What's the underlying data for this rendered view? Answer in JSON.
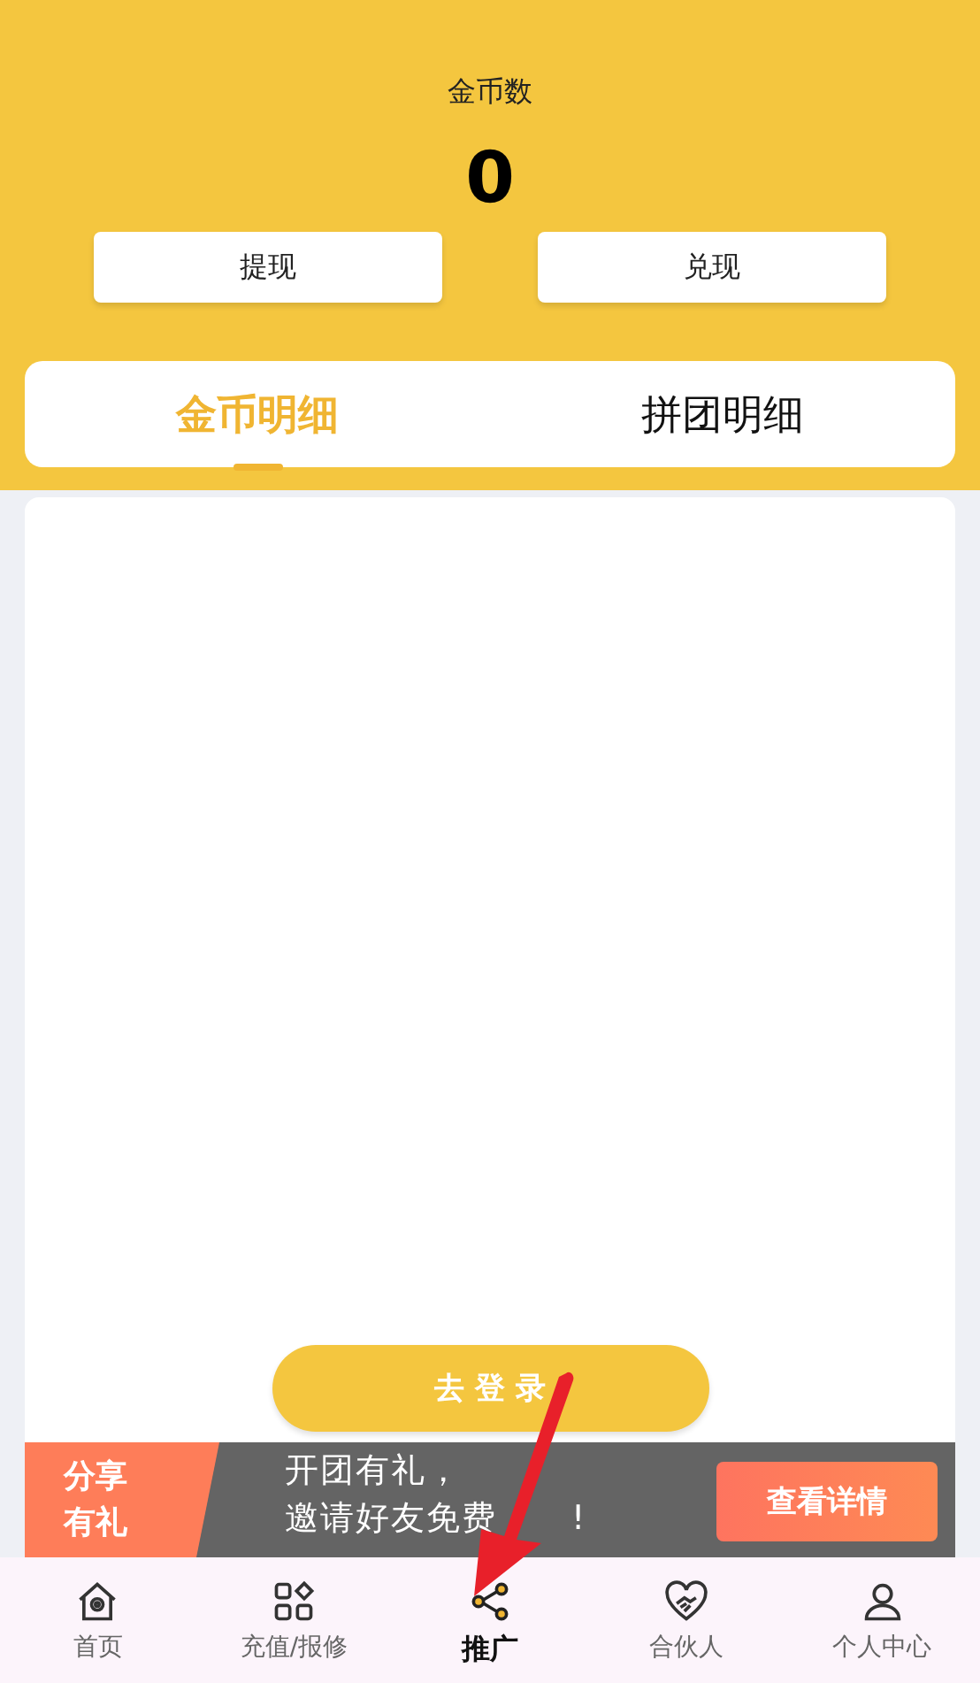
{
  "header": {
    "label": "金币数",
    "value": "0",
    "buttons": [
      "提现",
      "兑现"
    ]
  },
  "tabs": [
    {
      "label": "金币明细",
      "selected": true
    },
    {
      "label": "拼团明细",
      "selected": false
    }
  ],
  "login_button": "去 登 录",
  "promo": {
    "tag_lines": [
      "分享",
      "有礼"
    ],
    "lines": [
      [
        "开团有礼，"
      ],
      [
        "邀请好友免费",
        "!"
      ]
    ],
    "button": "查看详情"
  },
  "nav": [
    {
      "label": "首页",
      "kind": "home",
      "selected": false
    },
    {
      "label": "充值/报修",
      "kind": "grid",
      "selected": false
    },
    {
      "label": "推广",
      "kind": "share",
      "selected": true
    },
    {
      "label": "合伙人",
      "kind": "partner",
      "selected": false
    },
    {
      "label": "个人中心",
      "kind": "user",
      "selected": false
    }
  ]
}
